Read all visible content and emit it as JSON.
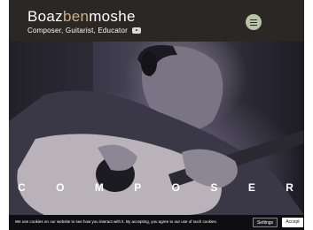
{
  "brand": {
    "name_part1": "Boaz",
    "name_part2": "ben",
    "name_part3": "moshe",
    "tagline": "Composer, Guitarist, Educator"
  },
  "icons": {
    "social": "youtube-icon",
    "menu": "hamburger-menu-icon"
  },
  "hero": {
    "headline_letters": [
      "C",
      "O",
      "M",
      "P",
      "O",
      "S",
      "E",
      "R"
    ]
  },
  "cookie_bar": {
    "text": "We use cookies on our website to see how you interact with it. By accepting, you agree to our use of such cookies.",
    "settings_label": "Settings",
    "accept_label": "Accept"
  },
  "colors": {
    "header_bg": "#2a2724",
    "brand_accent": "#c9b38a",
    "menu_button": "#b9c4a3",
    "cookie_bg": "#0e0e10"
  }
}
